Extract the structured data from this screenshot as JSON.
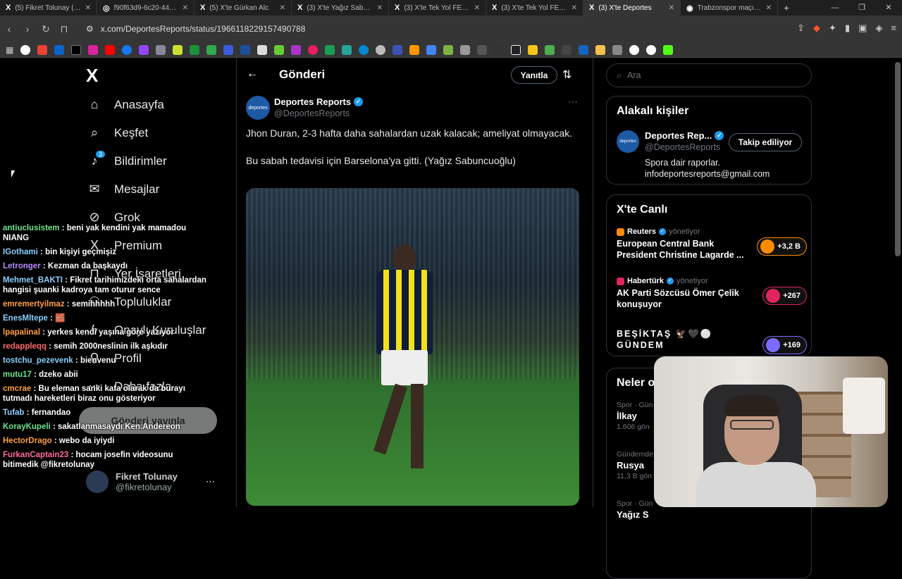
{
  "browser": {
    "tabs": [
      {
        "label": "(5) Fikret Tolunay (@fi",
        "icon": "X"
      },
      {
        "label": "f90f63d9-6c20-4422-",
        "icon": "◎"
      },
      {
        "label": "(5) X'te Gürkan Alc",
        "icon": "X"
      },
      {
        "label": "(3) X'te Yağız Sabunc",
        "icon": "X"
      },
      {
        "label": "(3) X'te Tek Yol FENER",
        "icon": "X"
      },
      {
        "label": "(3) X'te Tek Yol FENER",
        "icon": "X"
      },
      {
        "label": "(3) X'te Deportes",
        "icon": "X",
        "active": true
      },
      {
        "label": "Trabzonspor maçının",
        "icon": "◉"
      }
    ],
    "new_tab": "+",
    "url": "x.com/DeportesReports/status/1966118229157490788"
  },
  "sidebar": {
    "logo": "X",
    "items": [
      {
        "label": "Anasayfa",
        "icon": "⌂"
      },
      {
        "label": "Keşfet",
        "icon": "⌕"
      },
      {
        "label": "Bildirimler",
        "icon": "♪",
        "badge": "3"
      },
      {
        "label": "Mesajlar",
        "icon": "✉"
      },
      {
        "label": "Grok",
        "icon": "⊘"
      },
      {
        "label": "Premium",
        "icon": "X"
      },
      {
        "label": "Yer İşaretleri",
        "icon": "⊓"
      },
      {
        "label": "Topluluklar",
        "icon": "⚇"
      },
      {
        "label": "Onaylı Kuruluşlar",
        "icon": "ϟ"
      },
      {
        "label": "Profil",
        "icon": "⚲"
      },
      {
        "label": "Daha fazla",
        "icon": "⋯"
      }
    ],
    "post_button": "Gönderi yayınla",
    "profile_name": "Fikret Tolunay",
    "profile_handle": "@fikretolunay"
  },
  "chat": [
    {
      "user": "antiuclusistem",
      "msg": "beni yak kendini yak mamadou NIANG",
      "color": "#6fe38e"
    },
    {
      "user": "IGothami",
      "msg": "bin kişiyi geçmişiz",
      "color": "#8ad0ff"
    },
    {
      "user": "Letronger",
      "msg": "Kezman da başkaydı",
      "color": "#b58cff"
    },
    {
      "user": "Mehmet_BAKTI",
      "msg": "Fikret tarihimizdeki orta sahalardan hangisi şuanki kadroya tam oturur sence",
      "color": "#8ad0ff"
    },
    {
      "user": "emremertyilmaz",
      "msg": "semihhhhh",
      "color": "#ff9f43"
    },
    {
      "user": "EnesMltepe",
      "msg": "🧱",
      "color": "#8ad0ff"
    },
    {
      "user": "lpapalinal",
      "msg": "yerkes kendi yaşına göre yazıyor",
      "color": "#ff9f43"
    },
    {
      "user": "redappleqq",
      "msg": "semih 2000neslinin ilk aşkıdır",
      "color": "#ff6b6b"
    },
    {
      "user": "tostchu_pezevenk",
      "msg": "bienvenu",
      "color": "#8ad0ff"
    },
    {
      "user": "mutu17",
      "msg": "dzeko abii",
      "color": "#6fe38e"
    },
    {
      "user": "cmcrae",
      "msg": "Bu eleman sanki kafa olarak da burayı tutmadı hareketleri biraz onu gösteriyor",
      "color": "#ff9f43"
    },
    {
      "user": "Tufab",
      "msg": "fernandao",
      "color": "#8ad0ff"
    },
    {
      "user": "KorayKupeli",
      "msg": "sakatlanmasaydı Ken.Andereon",
      "color": "#6fe38e"
    },
    {
      "user": "HectorDrago",
      "msg": "webo da iyiydi",
      "color": "#ff9f43"
    },
    {
      "user": "FurkanCaptain23",
      "msg": "hocam josefin videosunu bitimedik @fikretolunay",
      "color": "#ff6b9c"
    }
  ],
  "main": {
    "title": "Gönderi",
    "reply_button": "Yanıtla",
    "author_name": "Deportes Reports",
    "author_handle": "@DeportesReports",
    "author_avatar_text": "deportes",
    "text_lines": [
      "Jhon Duran, 2-3 hafta daha sahalardan uzak kalacak; ameliyat olmayacak.",
      "Bu sabah tedavisi için Barselona'ya gitti. (Yağız Sabuncuoğlu)"
    ]
  },
  "right": {
    "search_placeholder": "Ara",
    "related_title": "Alakalı kişiler",
    "related": {
      "name": "Deportes Rep...",
      "handle": "@DeportesReports",
      "follow_label": "Takip ediliyor",
      "bio_line1": "Spora dair raporlar.",
      "bio_line2": "infodeportesreports@gmail.com"
    },
    "live_title": "X'te Canlı",
    "live": [
      {
        "host": "Reuters",
        "role": "yönetiyor",
        "title": "European Central Bank President Christine Lagarde ...",
        "count": "+3,2 B"
      },
      {
        "host": "Habertürk",
        "role": "yönetiyor",
        "title": "AK Parti Sözcüsü Ömer Çelik konuşuyor",
        "count": "+267"
      },
      {
        "host": "",
        "role": "",
        "title": "BEŞİKTAŞ 🦅🖤⚪ GÜNDEM",
        "count": "+169"
      }
    ],
    "trends_title": "Neler oluyor",
    "trends": [
      {
        "category": "Spor · Gün",
        "name": "İlkay",
        "count": "1.606 gön"
      },
      {
        "category": "Gündemde",
        "name": "Rusya",
        "count": "11,3 B gön"
      },
      {
        "category": "Spor · Gün",
        "name": "Yağız S",
        "count": ""
      }
    ]
  }
}
